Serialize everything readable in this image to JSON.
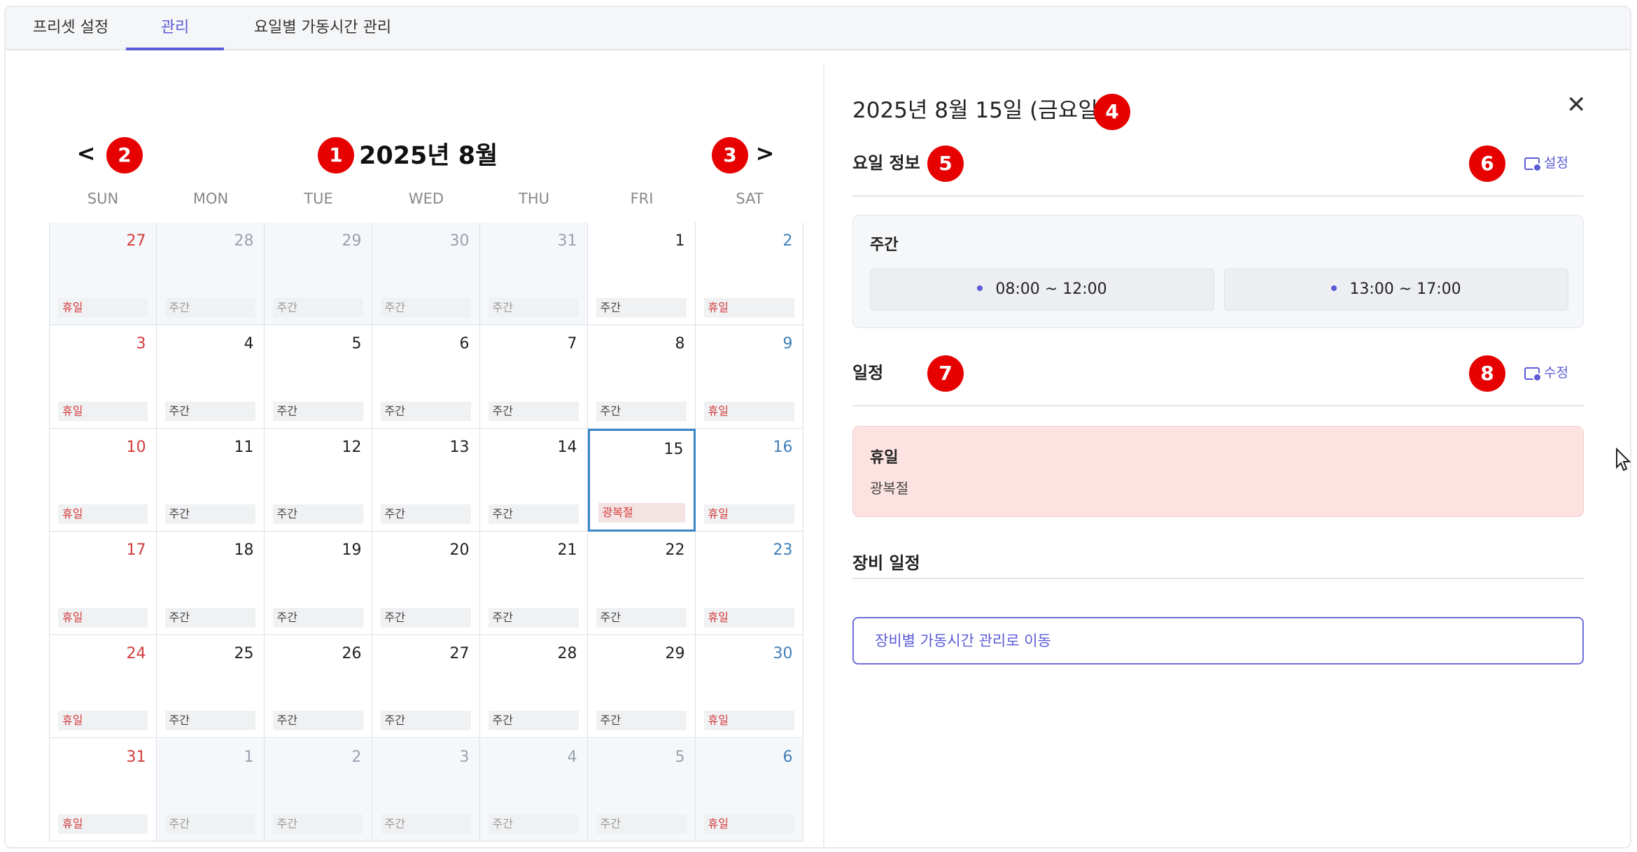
{
  "tabs": [
    {
      "label": "프리셋 설정",
      "active": false
    },
    {
      "label": "관리",
      "active": true
    },
    {
      "label": "요일별 가동시간 관리",
      "active": false
    }
  ],
  "calendar": {
    "title": "2025년 8월",
    "prev": "<",
    "next": ">",
    "weekdays": [
      "SUN",
      "MON",
      "TUE",
      "WED",
      "THU",
      "FRI",
      "SAT"
    ],
    "selected_day": "15",
    "rows": [
      [
        {
          "d": "27",
          "l": "휴일",
          "o": true
        },
        {
          "d": "28",
          "l": "주간",
          "o": true
        },
        {
          "d": "29",
          "l": "주간",
          "o": true
        },
        {
          "d": "30",
          "l": "주간",
          "o": true
        },
        {
          "d": "31",
          "l": "주간",
          "o": true
        },
        {
          "d": "1",
          "l": "주간",
          "o": false
        },
        {
          "d": "2",
          "l": "휴일",
          "o": false
        }
      ],
      [
        {
          "d": "3",
          "l": "휴일",
          "o": false
        },
        {
          "d": "4",
          "l": "주간",
          "o": false
        },
        {
          "d": "5",
          "l": "주간",
          "o": false
        },
        {
          "d": "6",
          "l": "주간",
          "o": false
        },
        {
          "d": "7",
          "l": "주간",
          "o": false
        },
        {
          "d": "8",
          "l": "주간",
          "o": false
        },
        {
          "d": "9",
          "l": "휴일",
          "o": false
        }
      ],
      [
        {
          "d": "10",
          "l": "휴일",
          "o": false
        },
        {
          "d": "11",
          "l": "주간",
          "o": false
        },
        {
          "d": "12",
          "l": "주간",
          "o": false
        },
        {
          "d": "13",
          "l": "주간",
          "o": false
        },
        {
          "d": "14",
          "l": "주간",
          "o": false
        },
        {
          "d": "15",
          "l": "광복절",
          "o": false
        },
        {
          "d": "16",
          "l": "휴일",
          "o": false
        }
      ],
      [
        {
          "d": "17",
          "l": "휴일",
          "o": false
        },
        {
          "d": "18",
          "l": "주간",
          "o": false
        },
        {
          "d": "19",
          "l": "주간",
          "o": false
        },
        {
          "d": "20",
          "l": "주간",
          "o": false
        },
        {
          "d": "21",
          "l": "주간",
          "o": false
        },
        {
          "d": "22",
          "l": "주간",
          "o": false
        },
        {
          "d": "23",
          "l": "휴일",
          "o": false
        }
      ],
      [
        {
          "d": "24",
          "l": "휴일",
          "o": false
        },
        {
          "d": "25",
          "l": "주간",
          "o": false
        },
        {
          "d": "26",
          "l": "주간",
          "o": false
        },
        {
          "d": "27",
          "l": "주간",
          "o": false
        },
        {
          "d": "28",
          "l": "주간",
          "o": false
        },
        {
          "d": "29",
          "l": "주간",
          "o": false
        },
        {
          "d": "30",
          "l": "휴일",
          "o": false
        }
      ],
      [
        {
          "d": "31",
          "l": "휴일",
          "o": false
        },
        {
          "d": "1",
          "l": "주간",
          "o": true
        },
        {
          "d": "2",
          "l": "주간",
          "o": true
        },
        {
          "d": "3",
          "l": "주간",
          "o": true
        },
        {
          "d": "4",
          "l": "주간",
          "o": true
        },
        {
          "d": "5",
          "l": "주간",
          "o": true
        },
        {
          "d": "6",
          "l": "휴일",
          "o": true
        }
      ]
    ]
  },
  "detail": {
    "date_title": "2025년 8월 15일 (금요일)",
    "close": "✕",
    "day_info": {
      "title": "요일 정보",
      "button": "설정",
      "shift_label": "주간",
      "slots": [
        "08:00 ~ 12:00",
        "13:00 ~ 17:00"
      ]
    },
    "schedule": {
      "title": "일정",
      "button": "수정",
      "event_title": "휴일",
      "event_desc": "광복절"
    },
    "equipment": {
      "title": "장비 일정",
      "link": "장비별 가동시간 관리로 이동"
    }
  },
  "badges": [
    "1",
    "2",
    "3",
    "4",
    "5",
    "6",
    "7",
    "8"
  ],
  "colors": {
    "accent": "#5b5bd6",
    "holiday": "#d23c3c",
    "saturday": "#3f7fb8",
    "badge": "#e60000",
    "event_bg": "#fde2e2"
  }
}
